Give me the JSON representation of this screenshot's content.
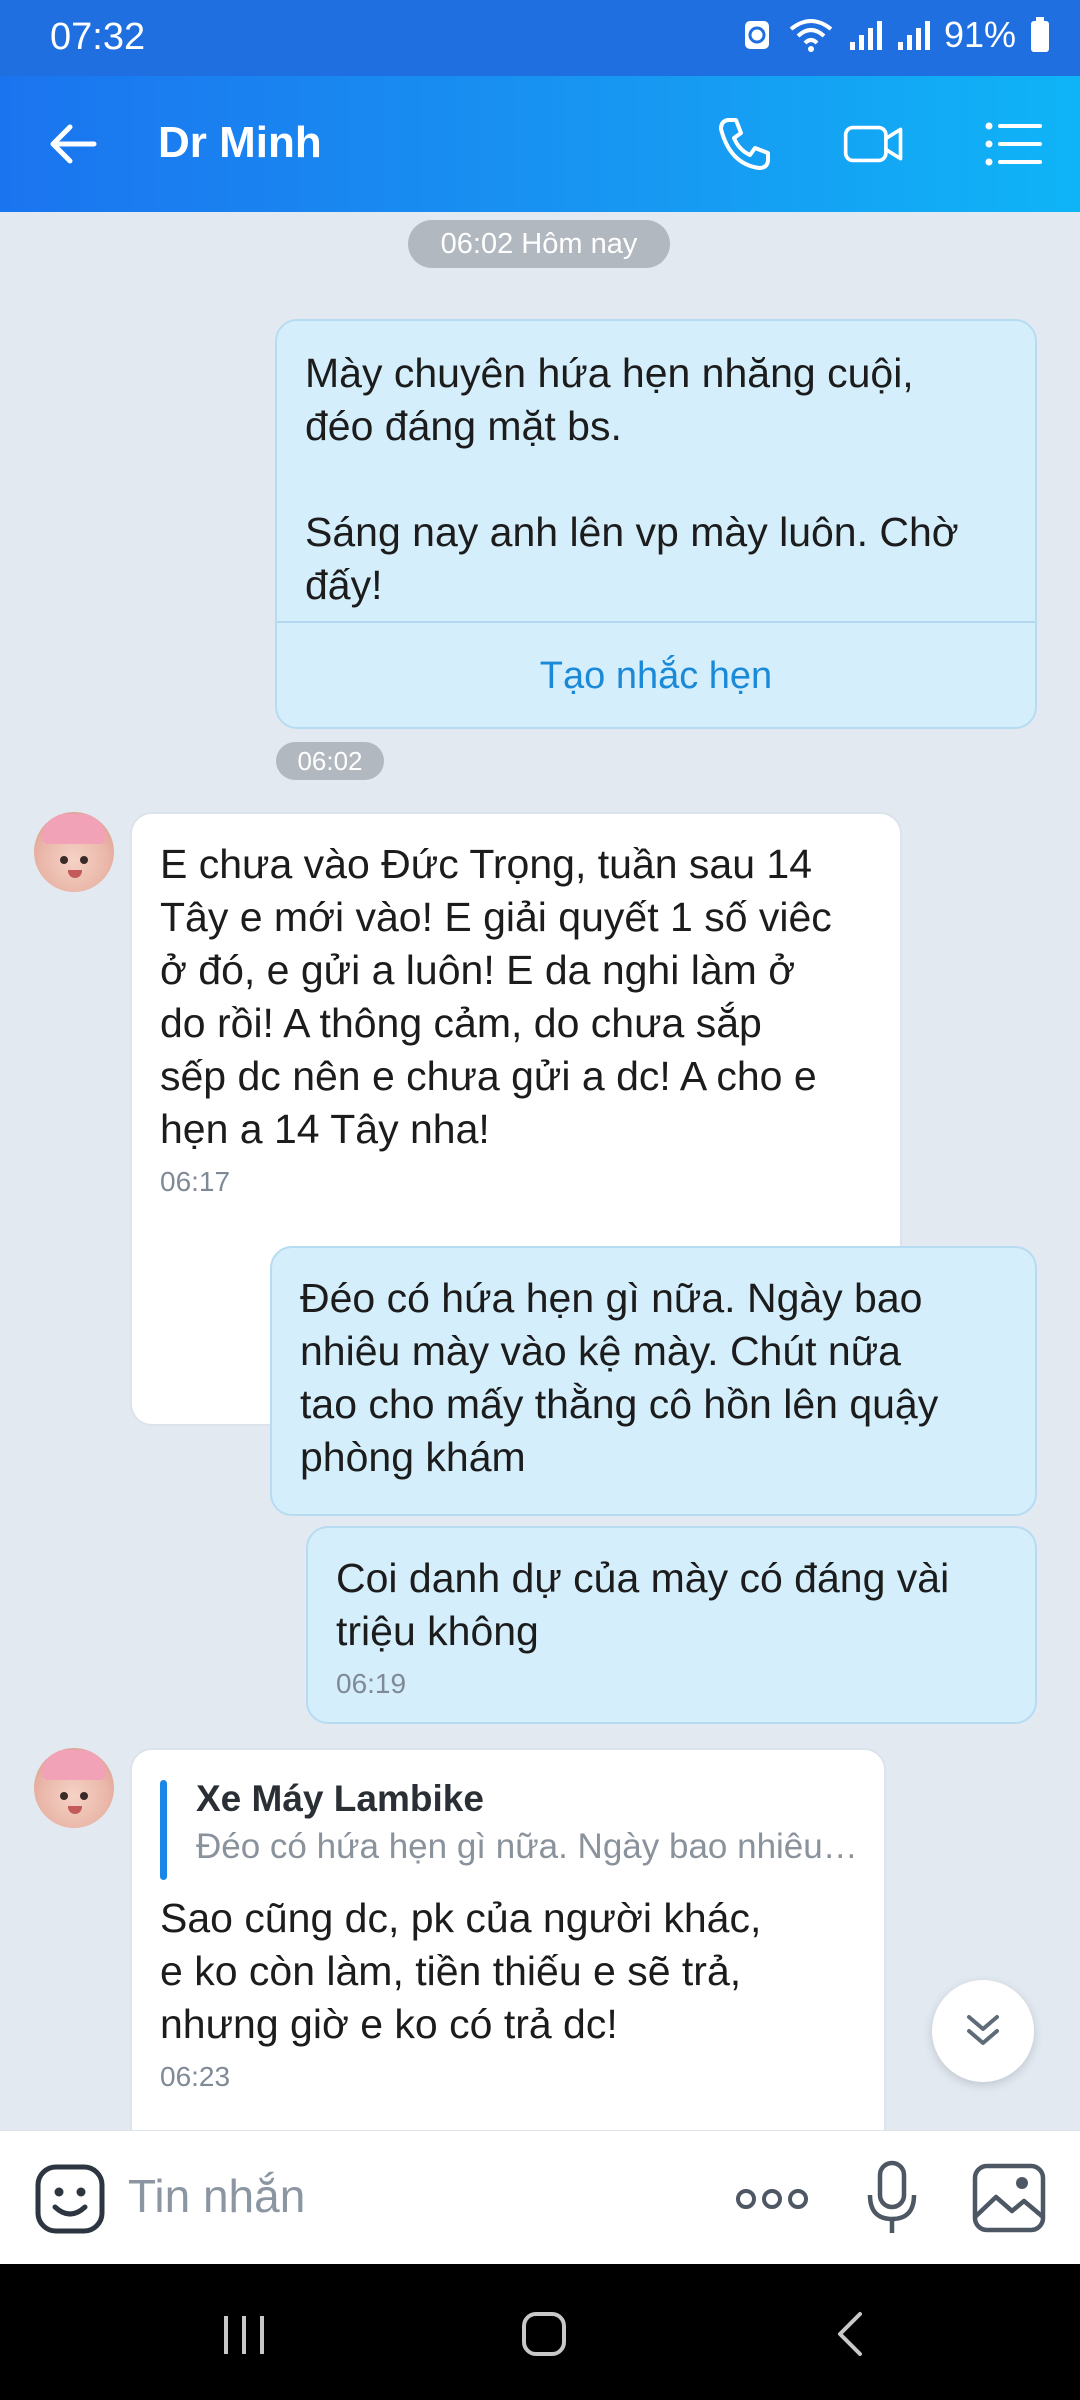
{
  "status_bar": {
    "time": "07:32",
    "battery": "91%"
  },
  "header": {
    "title": "Dr Minh"
  },
  "chat": {
    "date_separator": "06:02 Hôm nay",
    "time_separator": "06:02",
    "messages": [
      {
        "direction": "out",
        "text": "Mày chuyên hứa hẹn nhăng cuội,\nđéo đáng mặt bs.\n\nSáng nay anh lên vp mày luôn. Chờ\nđấy!",
        "action_label": "Tạo nhắc hẹn"
      },
      {
        "direction": "in",
        "text": "E chưa vào Đức Trọng, tuần sau 14\nTây e mới vào! E giải quyết 1 số viêc\nở đó, e gửi a luôn! E da nghi làm ở\ndo rồi! A thông cảm, do chưa sắp\nsếp dc nên e chưa gửi a dc! A cho e\nhẹn a 14 Tây nha!",
        "time": "06:17"
      },
      {
        "direction": "out",
        "text": "Đéo có hứa hẹn gì nữa. Ngày bao\nnhiêu mày vào kệ mày. Chút nữa\ntao cho mấy thằng cô hồn lên quậy\nphòng khám"
      },
      {
        "direction": "out",
        "text": "Coi danh dự của mày có đáng vài\ntriệu không",
        "time": "06:19"
      },
      {
        "direction": "in",
        "quote_name": "Xe Máy Lambike",
        "quote_text": "Đéo có hứa hẹn gì nữa. Ngày bao nhiêu…",
        "text": "Sao cũng dc, pk của người khác,\ne ko còn làm, tiền thiếu e sẽ trả,\nnhưng giờ e ko có trả dc!",
        "time": "06:23"
      }
    ]
  },
  "input": {
    "placeholder": "Tin nhắn"
  },
  "icons": {
    "back": "arrow-left-icon",
    "call": "phone-icon",
    "video": "video-camera-icon",
    "menu": "list-icon",
    "emoji": "emoji-icon",
    "more": "more-dots-icon",
    "mic": "microphone-icon",
    "image": "image-icon",
    "scroll": "chevron-double-down-icon"
  },
  "colors": {
    "header_start": "#1b74ef",
    "header_end": "#0fb4f7",
    "outgoing_bubble": "#d4eefc",
    "incoming_bubble": "#ffffff",
    "accent": "#1a8ad8"
  }
}
